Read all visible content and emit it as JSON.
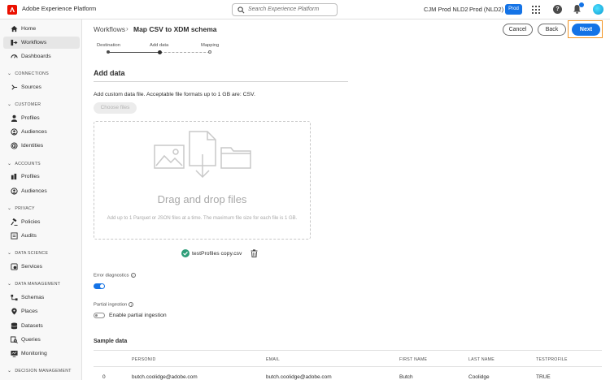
{
  "topbar": {
    "app_title": "Adobe Experience Platform",
    "search_placeholder": "Search Experience Platform",
    "org_name": "CJM Prod NLD2",
    "sandbox_name": "Prod (NLD2)",
    "sandbox_badge": "Prod"
  },
  "sidebar": {
    "home": "Home",
    "workflows": "Workflows",
    "dashboards": "Dashboards",
    "sections": {
      "connections": "CONNECTIONS",
      "customer": "CUSTOMER",
      "accounts": "ACCOUNTS",
      "privacy": "PRIVACY",
      "data_science": "DATA SCIENCE",
      "data_management": "DATA MANAGEMENT",
      "decision_management": "DECISION MANAGEMENT"
    },
    "sources": "Sources",
    "customer_profiles": "Profiles",
    "customer_audiences": "Audiences",
    "identities": "Identities",
    "account_profiles": "Profiles",
    "account_audiences": "Audiences",
    "policies": "Policies",
    "audits": "Audits",
    "services": "Services",
    "schemas": "Schemas",
    "places": "Places",
    "datasets": "Datasets",
    "queries": "Queries",
    "monitoring": "Monitoring"
  },
  "header": {
    "breadcrumb_parent": "Workflows",
    "breadcrumb_current": "Map CSV to XDM schema",
    "cancel_label": "Cancel",
    "back_label": "Back",
    "next_label": "Next"
  },
  "steps": [
    {
      "label": "Destination",
      "state": "complete"
    },
    {
      "label": "Add data",
      "state": "current"
    },
    {
      "label": "Mapping",
      "state": "upcoming"
    }
  ],
  "add_data": {
    "heading": "Add data",
    "description": "Add custom data file. Acceptable file formats up to 1 GB are: CSV.",
    "choose_files_label": "Choose files",
    "drop_title": "Drag and drop files",
    "drop_subtitle": "Add up to 1 Parquet or JSON files at a time. The maximum file size for each file is 1 GB.",
    "uploaded_file": "testProfiles copy.csv",
    "error_diagnostics_label": "Error diagnostics",
    "error_diagnostics_on": true,
    "partial_ingestion_label": "Partial ingestion",
    "enable_partial_label": "Enable partial ingestion",
    "partial_ingestion_on": false
  },
  "sample": {
    "heading": "Sample data",
    "columns": [
      "PERSONID",
      "EMAIL",
      "FIRST NAME",
      "LAST NAME",
      "TESTPROFILE"
    ],
    "rows": [
      {
        "index": "0",
        "cells": [
          "butch.coolidge@adobe.com",
          "butch.coolidge@adobe.com",
          "Butch",
          "Coolidge",
          "TRUE"
        ]
      }
    ]
  },
  "colors": {
    "accent": "#1473e6",
    "highlight": "#f29423",
    "success": "#2d9d78",
    "logo": "#eb1000"
  }
}
